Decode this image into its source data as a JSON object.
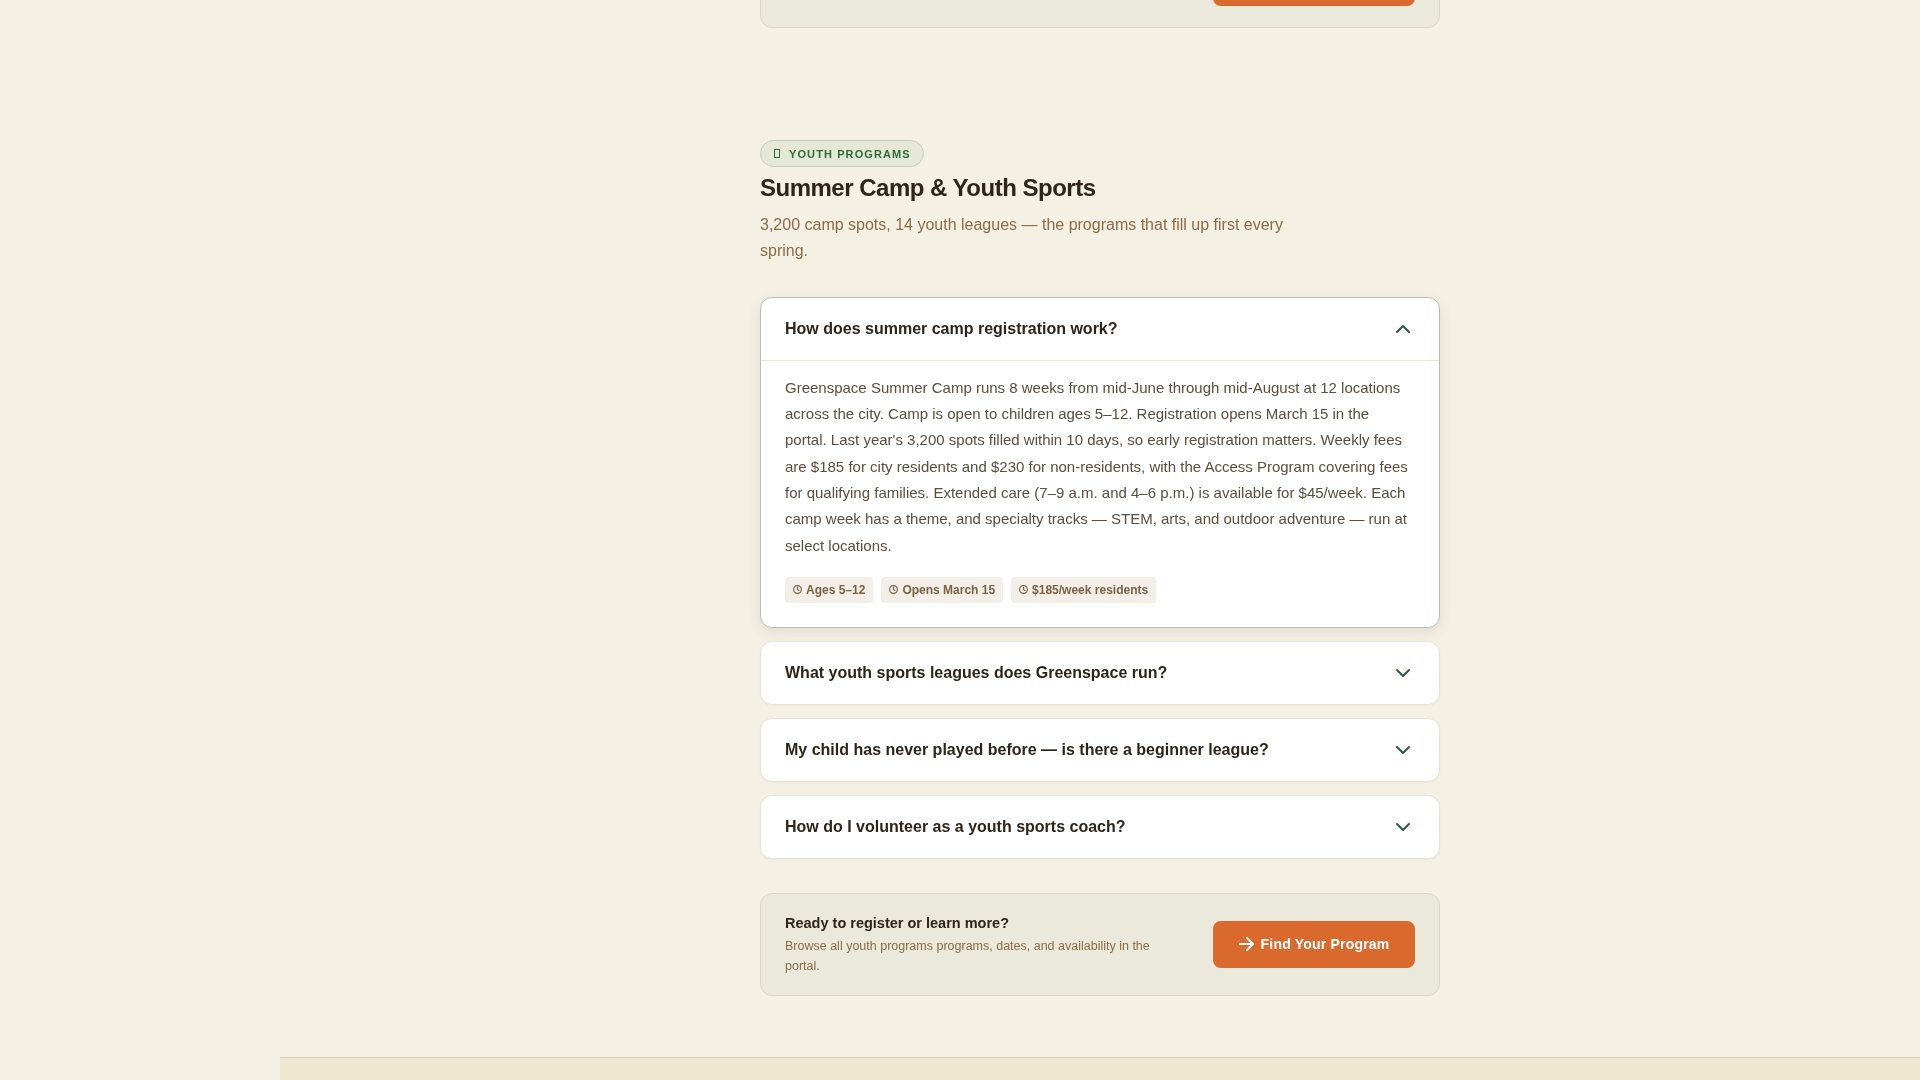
{
  "section": {
    "badge": "YOUTH PROGRAMS",
    "title": "Summer Camp & Youth Sports",
    "subtitle": "3,200 camp spots, 14 youth leagues — the programs that fill up first every spring."
  },
  "faq": [
    {
      "question": "How does summer camp registration work?",
      "expanded": true,
      "answer": "Greenspace Summer Camp runs 8 weeks from mid-June through mid-August at 12 locations across the city. Camp is open to children ages 5–12. Registration opens March 15 in the portal. Last year's 3,200 spots filled within 10 days, so early registration matters. Weekly fees are $185 for city residents and $230 for non-residents, with the Access Program covering fees for qualifying families. Extended care (7–9 a.m. and 4–6 p.m.) is available for $45/week. Each camp week has a theme, and specialty tracks — STEM, arts, and outdoor adventure — run at select locations.",
      "tags": [
        "Ages 5–12",
        "Opens March 15",
        "$185/week residents"
      ]
    },
    {
      "question": "What youth sports leagues does Greenspace run?",
      "expanded": false
    },
    {
      "question": "My child has never played before — is there a beginner league?",
      "expanded": false
    },
    {
      "question": "How do I volunteer as a youth sports coach?",
      "expanded": false
    }
  ],
  "cta": {
    "title": "Ready to register or learn more?",
    "text": "Browse all youth programs programs, dates, and availability in the portal.",
    "button": "Find Your Program"
  }
}
